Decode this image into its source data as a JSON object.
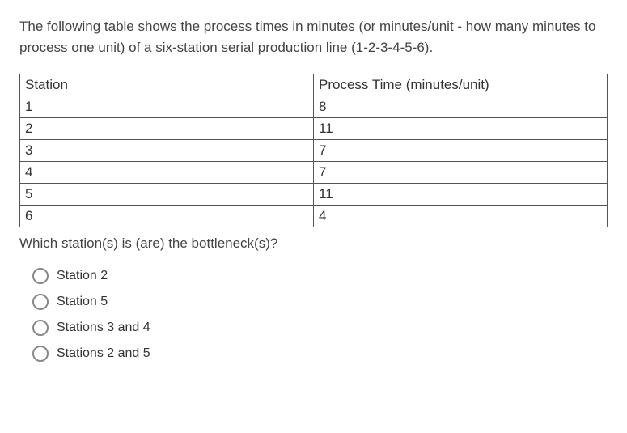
{
  "intro": "The following table shows the process times in minutes (or minutes/unit - how many minutes to process one unit) of a six-station serial production line (1-2-3-4-5-6).",
  "table": {
    "headers": [
      "Station",
      "Process Time (minutes/unit)"
    ],
    "rows": [
      {
        "station": "1",
        "time": "8"
      },
      {
        "station": "2",
        "time": "11"
      },
      {
        "station": "3",
        "time": "7"
      },
      {
        "station": "4",
        "time": "7"
      },
      {
        "station": "5",
        "time": "11"
      },
      {
        "station": "6",
        "time": "4"
      }
    ]
  },
  "question": "Which station(s) is (are) the bottleneck(s)?",
  "options": [
    "Station 2",
    "Station 5",
    "Stations 3 and 4",
    "Stations 2 and 5"
  ]
}
